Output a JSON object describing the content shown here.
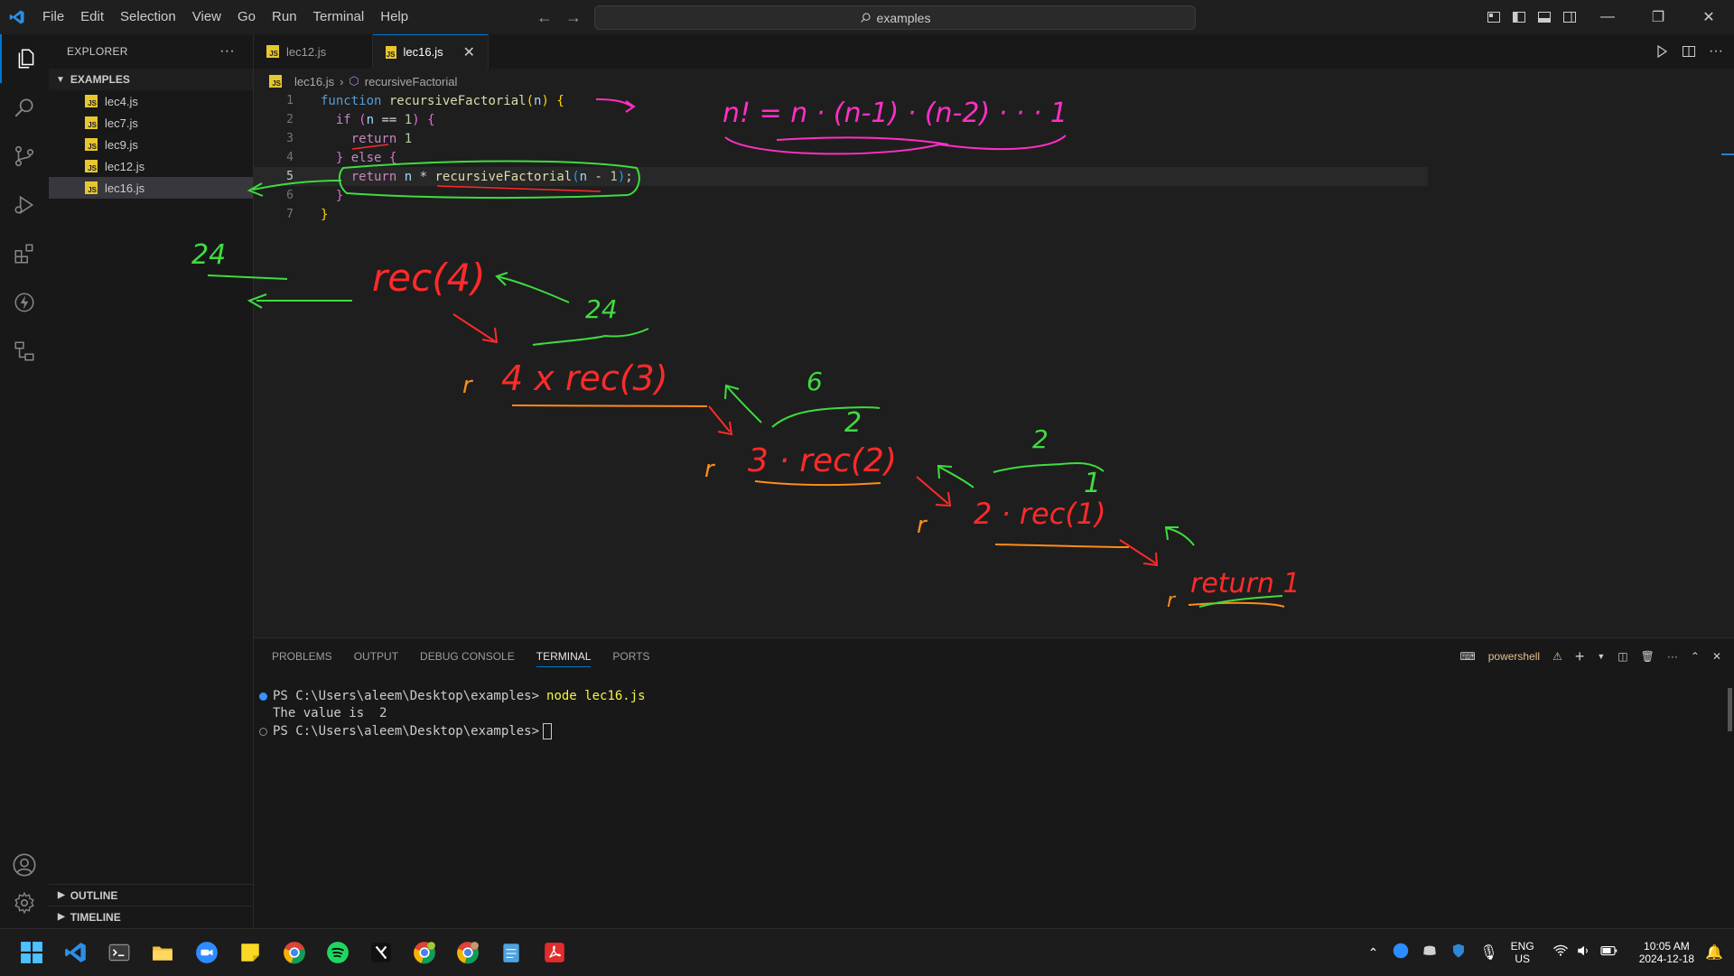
{
  "titlebar": {
    "menu": [
      "File",
      "Edit",
      "Selection",
      "View",
      "Go",
      "Run",
      "Terminal",
      "Help"
    ],
    "search_text": "examples"
  },
  "explorer": {
    "title": "EXPLORER",
    "more": "···",
    "folder": "EXAMPLES",
    "files": [
      "lec4.js",
      "lec7.js",
      "lec9.js",
      "lec12.js",
      "lec16.js"
    ],
    "active_file": "lec16.js",
    "outline": "OUTLINE",
    "timeline": "TIMELINE"
  },
  "tabs": [
    {
      "label": "lec12.js",
      "active": false
    },
    {
      "label": "lec16.js",
      "active": true
    }
  ],
  "breadcrumb": {
    "file": "lec16.js",
    "symbol": "recursiveFactorial"
  },
  "code": {
    "line_numbers": [
      "1",
      "2",
      "3",
      "4",
      "5",
      "6",
      "7"
    ],
    "l1": {
      "kw": "function",
      "name": "recursiveFactorial",
      "param": "n"
    },
    "l2": {
      "kw": "if",
      "var": "n",
      "op": "==",
      "num": "1"
    },
    "l3": {
      "kw": "return",
      "num": "1"
    },
    "l4": {
      "kw": "else"
    },
    "l5": {
      "kw": "return",
      "var": "n",
      "op": "*",
      "call": "recursiveFactorial",
      "arg": "n",
      "minus": "-",
      "num": "1"
    }
  },
  "panel": {
    "tabs": [
      "PROBLEMS",
      "OUTPUT",
      "DEBUG CONSOLE",
      "TERMINAL",
      "PORTS"
    ],
    "active_tab": "TERMINAL",
    "shell": "powershell",
    "lines": [
      {
        "prompt": "PS C:\\Users\\aleem\\Desktop\\examples>",
        "cmd": "node lec16.js"
      },
      {
        "output": "The value is  2"
      },
      {
        "prompt": "PS C:\\Users\\aleem\\Desktop\\examples>",
        "cmd": ""
      }
    ]
  },
  "annotations": {
    "formula": "n! = n · (n-1) · (n-2) · · · 1",
    "rec4": "rec(4)",
    "four_times": "4 x rec(3)",
    "three_times": "3 · rec(2)",
    "two_times": "2 · rec(1)",
    "return1": "return 1",
    "v24a": "24",
    "v24b": "24",
    "v6": "6",
    "v2a": "2",
    "v2b": "2",
    "v1": "1",
    "r": "r"
  },
  "taskbar": {
    "lang": "ENG",
    "region": "US",
    "time": "10:05 AM",
    "date": "2024-12-18",
    "colors": {
      "ink_green": "#3fdc3f",
      "ink_red": "#ff2a2a",
      "ink_pink": "#ff2fc4",
      "ink_orange": "#ff8c1a"
    }
  }
}
